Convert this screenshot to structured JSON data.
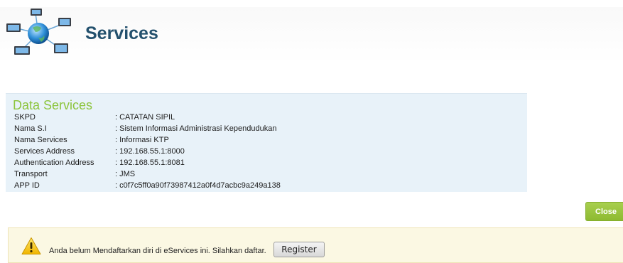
{
  "header": {
    "title": "Services",
    "logo_icon": "network-services-icon"
  },
  "data_services": {
    "title": "Data Services",
    "rows": [
      {
        "label": "SKPD",
        "value": ": CATATAN SIPIL"
      },
      {
        "label": "Nama S.I",
        "value": ": Sistem Informasi Administrasi Kependudukan"
      },
      {
        "label": "Nama Services",
        "value": ": Informasi KTP"
      },
      {
        "label": "Services Address",
        "value": ": 192.168.55.1:8000"
      },
      {
        "label": "Authentication Address",
        "value": ": 192.168.55.1:8081"
      },
      {
        "label": "Transport",
        "value": ": JMS"
      },
      {
        "label": "APP ID",
        "value": ": c0f7c5ff0a90f73987412a0f4d7acbc9a249a138"
      }
    ]
  },
  "actions": {
    "close_label": "Close"
  },
  "notice": {
    "icon": "warning-icon",
    "message": "Anda belum Mendaftarkan diri di eServices ini. Silahkan daftar.",
    "register_label": "Register"
  },
  "colors": {
    "title": "#23506d",
    "panel_bg": "#e8f2f9",
    "panel_title": "#8cc43c",
    "close_button": "#99c43d",
    "notice_bg": "#fbf8e3"
  }
}
